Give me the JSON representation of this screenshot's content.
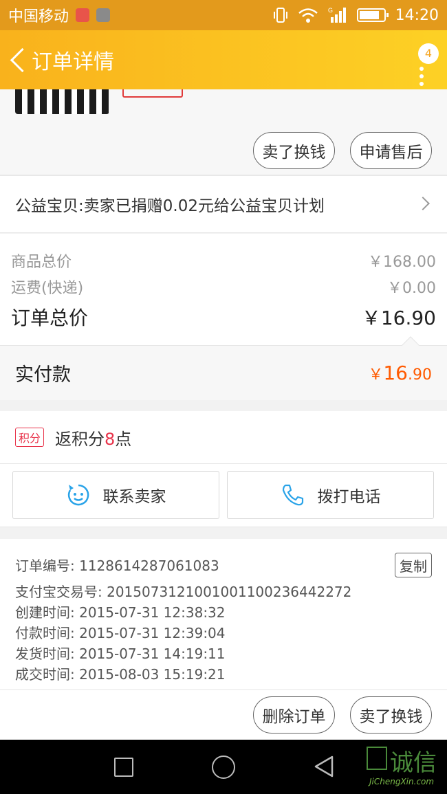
{
  "status_bar": {
    "carrier": "中国移动",
    "time": "14:20"
  },
  "header": {
    "title": "订单详情",
    "badge_count": "4"
  },
  "product": {
    "buttons": [
      "卖了换钱",
      "申请售后"
    ]
  },
  "charity": {
    "text": "公益宝贝:卖家已捐赠0.02元给公益宝贝计划"
  },
  "prices": {
    "rows": [
      {
        "label": "商品总价",
        "value": "￥168.00"
      },
      {
        "label": "运费(快递)",
        "value": "￥0.00"
      }
    ],
    "total": {
      "label": "订单总价",
      "value": "￥16.90"
    }
  },
  "paid": {
    "label": "实付款",
    "currency": "￥",
    "integer": "16",
    "decimal": ".90"
  },
  "points": {
    "badge": "积分",
    "prefix": "返积分",
    "number": "8",
    "suffix": "点"
  },
  "contacts": {
    "seller": "联系卖家",
    "phone": "拨打电话"
  },
  "order_info": {
    "copy_label": "复制",
    "rows": [
      "订单编号: 1128614287061083",
      "支付宝交易号: 2015073121001001100236442272",
      "创建时间: 2015-07-31 12:38:32",
      "付款时间: 2015-07-31 12:39:04",
      "发货时间: 2015-07-31 14:19:11",
      "成交时间: 2015-08-03 15:19:21"
    ]
  },
  "actions": {
    "delete": "删除订单",
    "sell": "卖了换钱"
  },
  "watermark": {
    "text": "诚信",
    "sub": "JiChengXin.com"
  },
  "colors": {
    "header_start": "#f9b21c",
    "header_end": "#fdd125",
    "paid_amount": "#ff5a00",
    "points_accent": "#e8334a"
  }
}
